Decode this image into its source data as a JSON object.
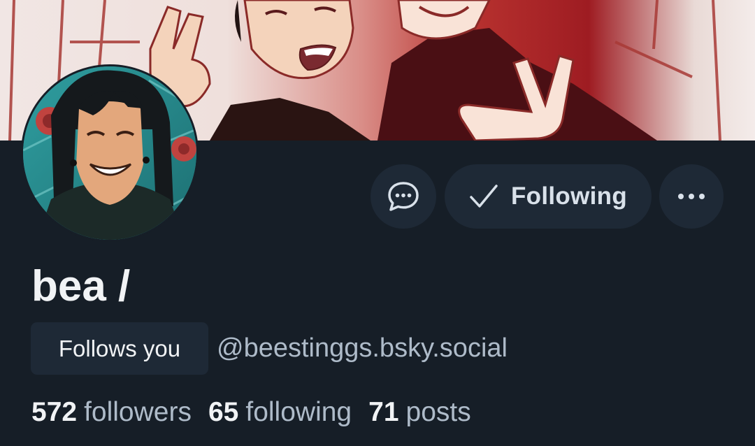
{
  "profile": {
    "display_name": "bea /",
    "handle": "@beestinggs.bsky.social",
    "follows_you_badge": "Follows you"
  },
  "actions": {
    "follow_label": "Following"
  },
  "stats": {
    "followers_count": "572",
    "followers_label": "followers",
    "following_count": "65",
    "following_label": "following",
    "posts_count": "71",
    "posts_label": "posts"
  },
  "icons": {
    "message": "chat-bubble-icon",
    "check": "check-icon",
    "more": "more-horizontal-icon"
  },
  "colors": {
    "background": "#161e27",
    "button_bg": "#1e2936",
    "text_primary": "#f1f3f5",
    "text_secondary": "#aebbc9"
  }
}
